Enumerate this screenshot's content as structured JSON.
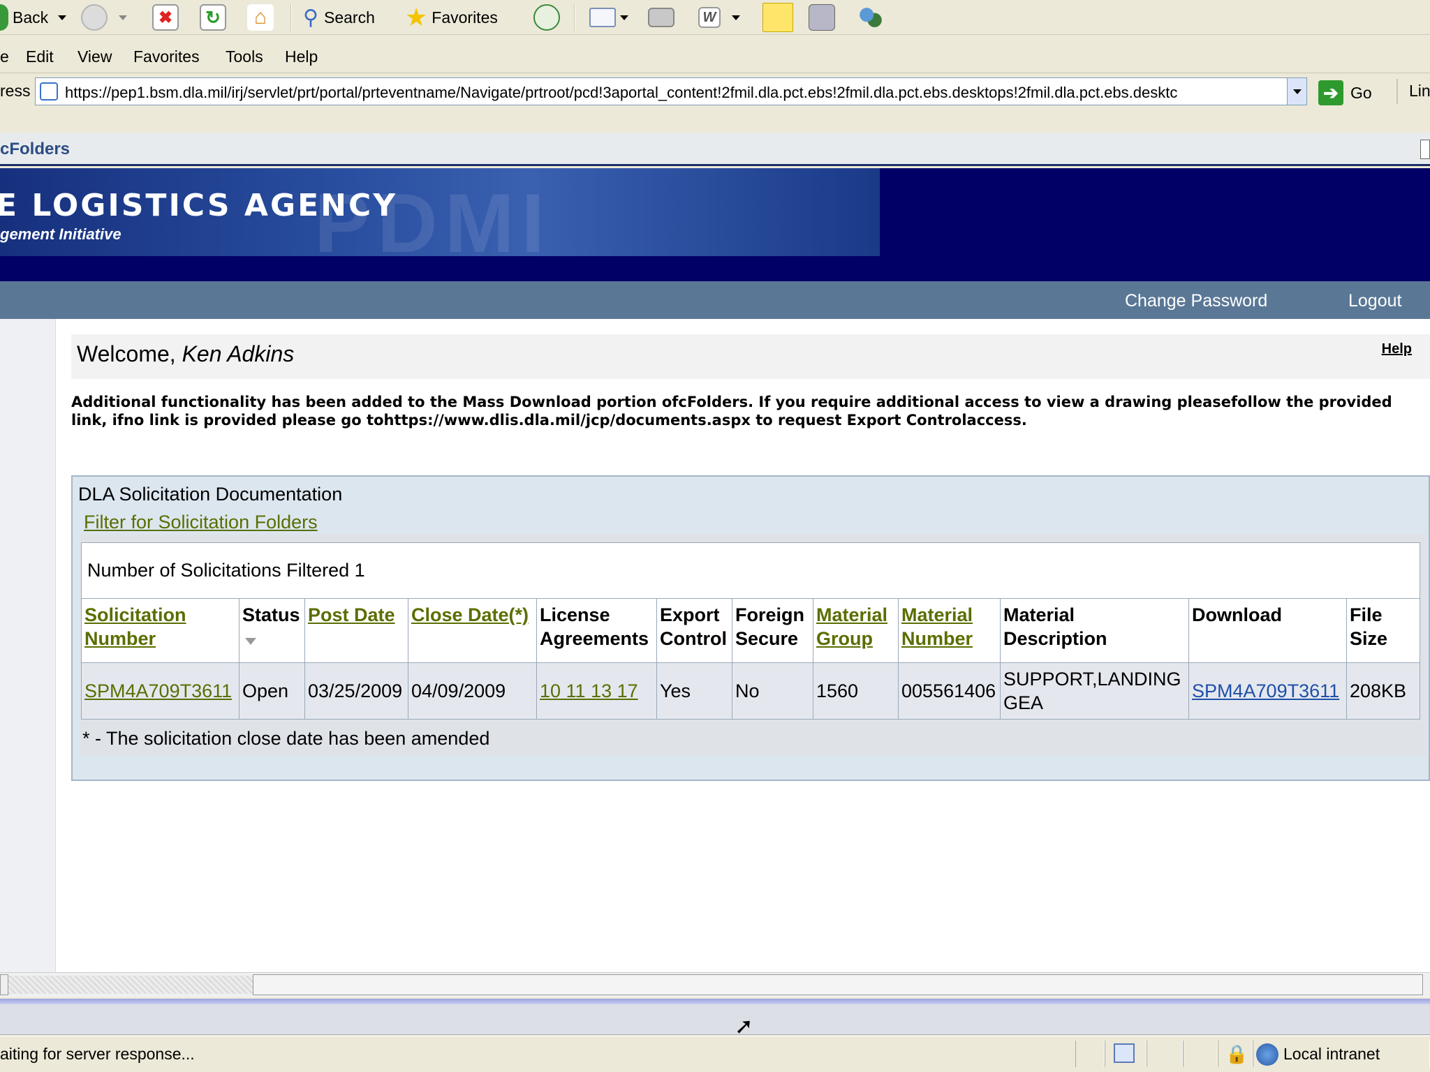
{
  "toolbar": {
    "back_label": "Back",
    "search_label": "Search",
    "favorites_label": "Favorites"
  },
  "menu": [
    "e",
    "Edit",
    "View",
    "Favorites",
    "Tools",
    "Help"
  ],
  "address": {
    "label": "ress",
    "url": "https://pep1.bsm.dla.mil/irj/servlet/prt/portal/prteventname/Navigate/prtroot/pcd!3aportal_content!2fmil.dla.pct.ebs!2fmil.dla.pct.ebs.desktops!2fmil.dla.pct.ebs.desktc",
    "go_label": "Go",
    "links_label": "Lin"
  },
  "portal": {
    "title": "cFolders",
    "banner_main": "E LOGISTICS AGENCY",
    "banner_sub": "gement Initiative",
    "nav": {
      "change_password": "Change Password",
      "logout": "Logout"
    }
  },
  "welcome": {
    "prefix": "Welcome, ",
    "name": "Ken Adkins",
    "help": "Help"
  },
  "notice": "Additional functionality has been added to the Mass Download portion ofcFolders. If you require additional access to view a drawing pleasefollow the provided link, ifno link is provided please go tohttps://www.dlis.dla.mil/jcp/documents.aspx to request Export Controlaccess.",
  "solicitation": {
    "panel_title": "DLA Solicitation Documentation",
    "filter_link": "Filter for Solicitation Folders ",
    "count_text": "Number of Solicitations Filtered 1",
    "columns": {
      "sol_number": [
        "Solicitation",
        "Number"
      ],
      "status": "Status",
      "post_date": "Post Date",
      "close_date": "Close Date(*)",
      "license": [
        "License",
        "Agreements"
      ],
      "export": [
        "Export",
        "Control"
      ],
      "foreign": [
        "Foreign",
        "Secure"
      ],
      "mat_group": [
        "Material",
        "Group"
      ],
      "mat_number": [
        "Material",
        "Number"
      ],
      "mat_desc": [
        "Material",
        "Description"
      ],
      "download": "Download",
      "file_size": [
        "File",
        "Size"
      ]
    },
    "row": {
      "sol_number": "SPM4A709T3611",
      "status": "Open",
      "post_date": "03/25/2009",
      "close_date": "04/09/2009",
      "license": "10 11 13 17",
      "export": "Yes",
      "foreign": "No",
      "mat_group": "1560",
      "mat_number": "005561406",
      "mat_desc": "SUPPORT,LANDING GEA",
      "download": "SPM4A709T3611",
      "file_size": "208KB"
    },
    "footnote": "* - The solicitation close date has been amended"
  },
  "status": {
    "text": "aiting for server response...",
    "zone": "Local intranet"
  }
}
